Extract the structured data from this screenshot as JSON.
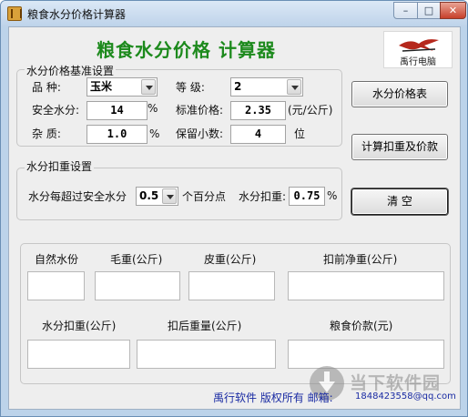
{
  "window": {
    "title": "粮食水分价格计算器",
    "minimize": "–",
    "maximize": "□",
    "close": "✕"
  },
  "header": {
    "title": "粮食水分价格  计算器",
    "logo_text": "禹行电脑"
  },
  "base_settings": {
    "legend": "水分价格基准设置",
    "variety_label": "品    种:",
    "variety_value": "玉米",
    "grade_label": "等    级:",
    "grade_value": "2",
    "safe_moisture_label": "安全水分:",
    "safe_moisture_value": "14",
    "safe_moisture_unit": "%",
    "standard_price_label": "标准价格:",
    "standard_price_value": "2.35",
    "standard_price_unit": "(元/公斤)",
    "impurity_label": "杂    质:",
    "impurity_value": "1.0",
    "impurity_unit": "%",
    "decimals_label": "保留小数:",
    "decimals_value": "4",
    "decimals_unit": "位"
  },
  "deduction_settings": {
    "legend": "水分扣重设置",
    "over_label": "水分每超过安全水分",
    "over_value": "0.5",
    "over_unit": "个百分点",
    "deduct_label": "水分扣重:",
    "deduct_value": "0.75",
    "deduct_unit": "%"
  },
  "buttons": {
    "moisture_price_table": "水分价格表",
    "calc": "计算扣重及价款",
    "clear": "清    空"
  },
  "results": {
    "natural_moisture": "自然水份",
    "gross_weight": "毛重(公斤)",
    "tare_weight": "皮重(公斤)",
    "net_before": "扣前净重(公斤)",
    "moisture_deduction": "水分扣重(公斤)",
    "net_after": "扣后重量(公斤)",
    "grain_price": "粮食价款(元)"
  },
  "footer": {
    "copyright": "禹行软件  版权所有  邮箱:",
    "email": "1848423558@qq.com"
  },
  "watermark": {
    "text": "当下软件园"
  },
  "colors": {
    "title_green": "#1d8a1d",
    "footer_blue": "#1a2ba3"
  }
}
